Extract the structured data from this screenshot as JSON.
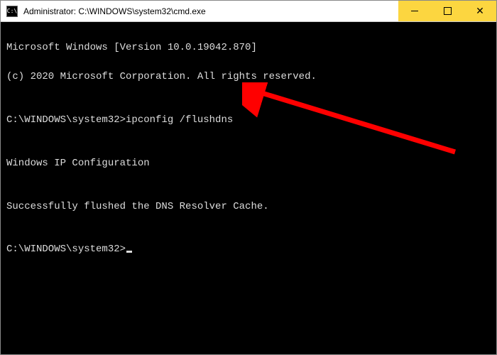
{
  "window": {
    "icon_label": "C:\\",
    "title": "Administrator: C:\\WINDOWS\\system32\\cmd.exe"
  },
  "controls": {
    "minimize": "Minimize",
    "maximize": "Maximize",
    "close": "✕"
  },
  "terminal": {
    "line1": "Microsoft Windows [Version 10.0.19042.870]",
    "line2": "(c) 2020 Microsoft Corporation. All rights reserved.",
    "blank1": "",
    "prompt1_path": "C:\\WINDOWS\\system32>",
    "prompt1_cmd": "ipconfig /flushdns",
    "blank2": "",
    "msg1": "Windows IP Configuration",
    "blank3": "",
    "msg2": "Successfully flushed the DNS Resolver Cache.",
    "blank4": "",
    "prompt2_path": "C:\\WINDOWS\\system32>"
  }
}
